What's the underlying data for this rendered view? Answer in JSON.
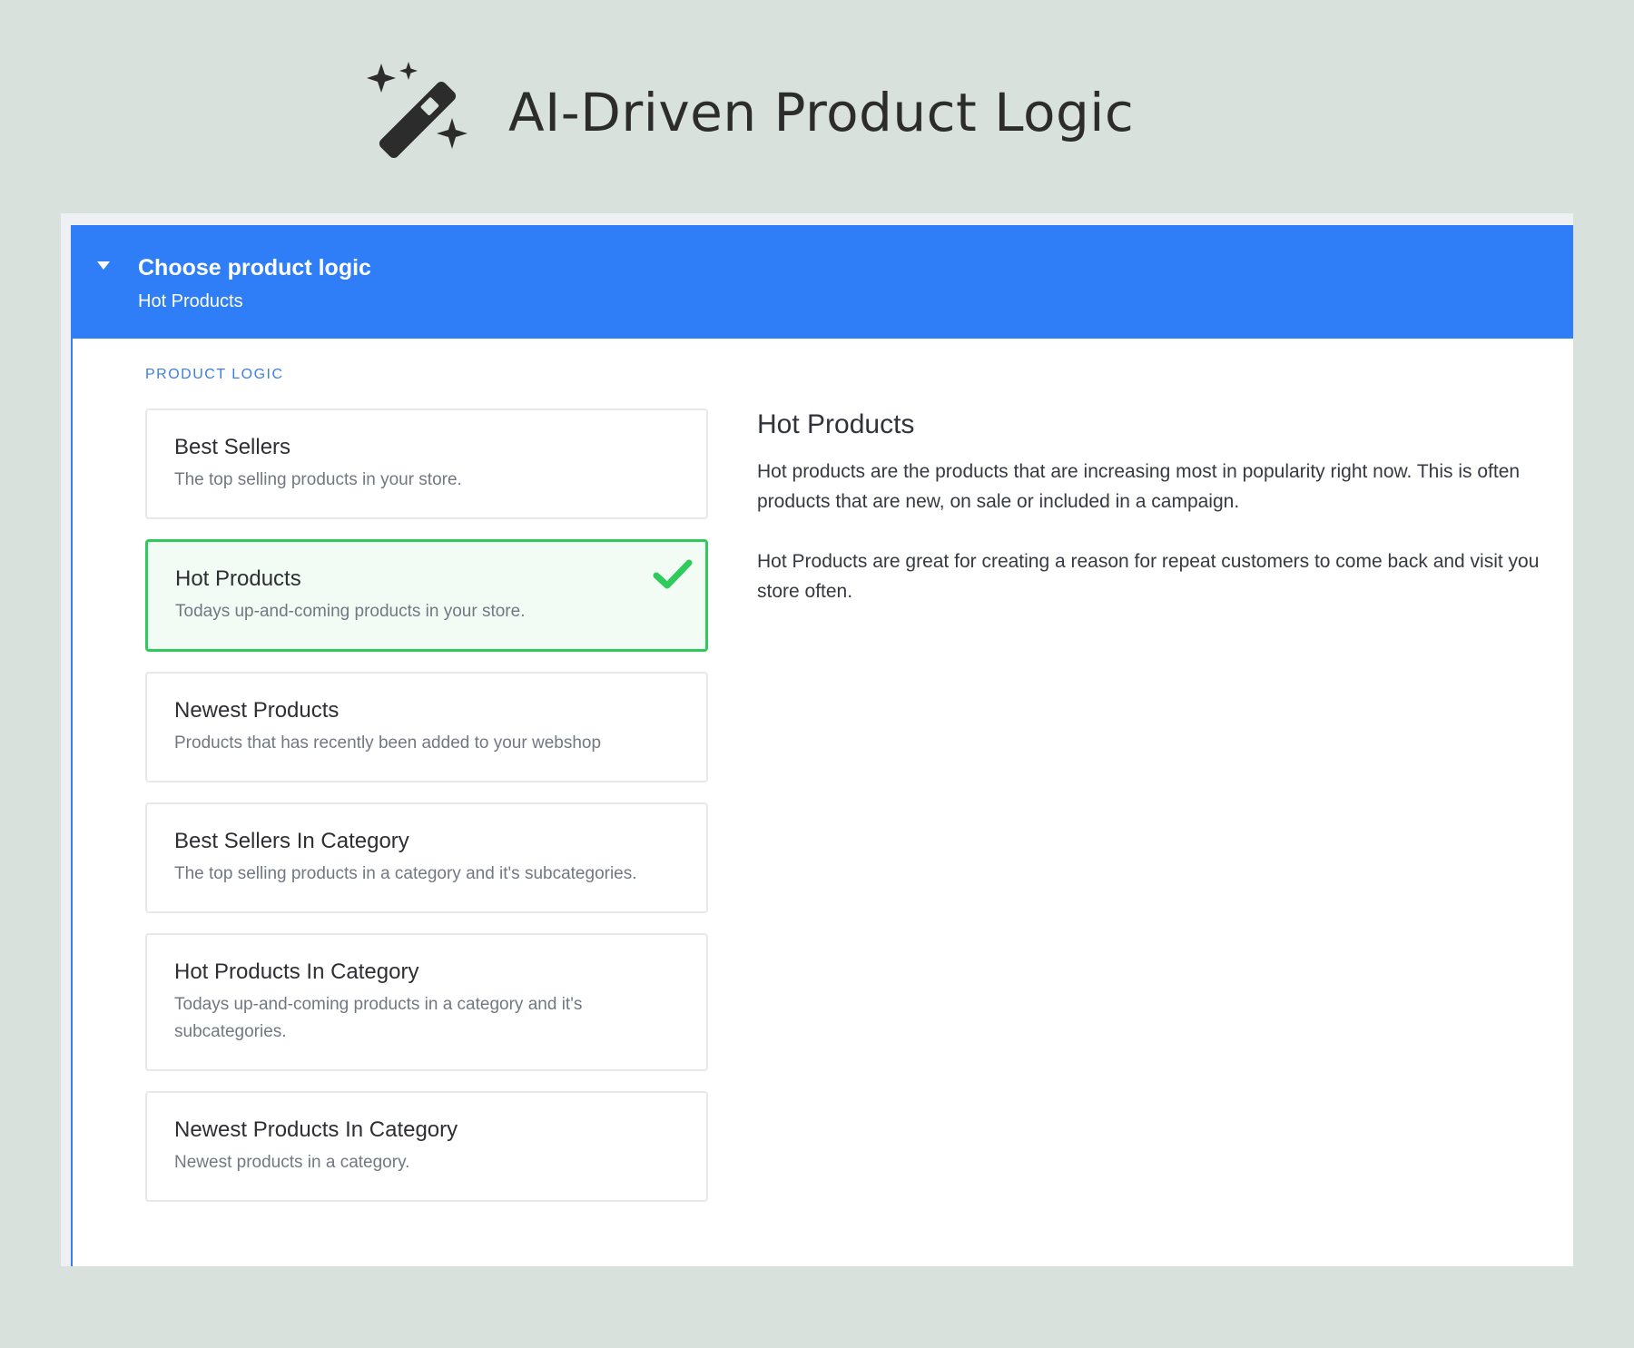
{
  "hero": {
    "title": "AI-Driven Product Logic",
    "icon": "magic-wand-icon"
  },
  "panel": {
    "title": "Choose product logic",
    "subtitle": "Hot Products",
    "toggle_icon": "caret-down-icon",
    "accent_color": "#2f7ef7"
  },
  "section_label": "PRODUCT LOGIC",
  "options": [
    {
      "title": "Best Sellers",
      "description": "The top selling products in your store.",
      "selected": false
    },
    {
      "title": "Hot Products",
      "description": "Todays up-and-coming products in your store.",
      "selected": true
    },
    {
      "title": "Newest Products",
      "description": "Products that has recently been added to your webshop",
      "selected": false
    },
    {
      "title": "Best Sellers In Category",
      "description": "The top selling products in a category and it's subcategories.",
      "selected": false
    },
    {
      "title": "Hot Products In Category",
      "description": "Todays up-and-coming products in a category and it's subcategories.",
      "selected": false
    },
    {
      "title": "Newest Products In Category",
      "description": "Newest products in a category.",
      "selected": false
    }
  ],
  "selected_color": "#2ecb5c",
  "detail": {
    "title": "Hot Products",
    "paragraphs": [
      "Hot products are the products that are increasing most in popularity right now. This is often products that are new, on sale or included in a campaign.",
      "Hot Products are great for creating a reason for repeat customers to come back and visit you store often."
    ]
  }
}
